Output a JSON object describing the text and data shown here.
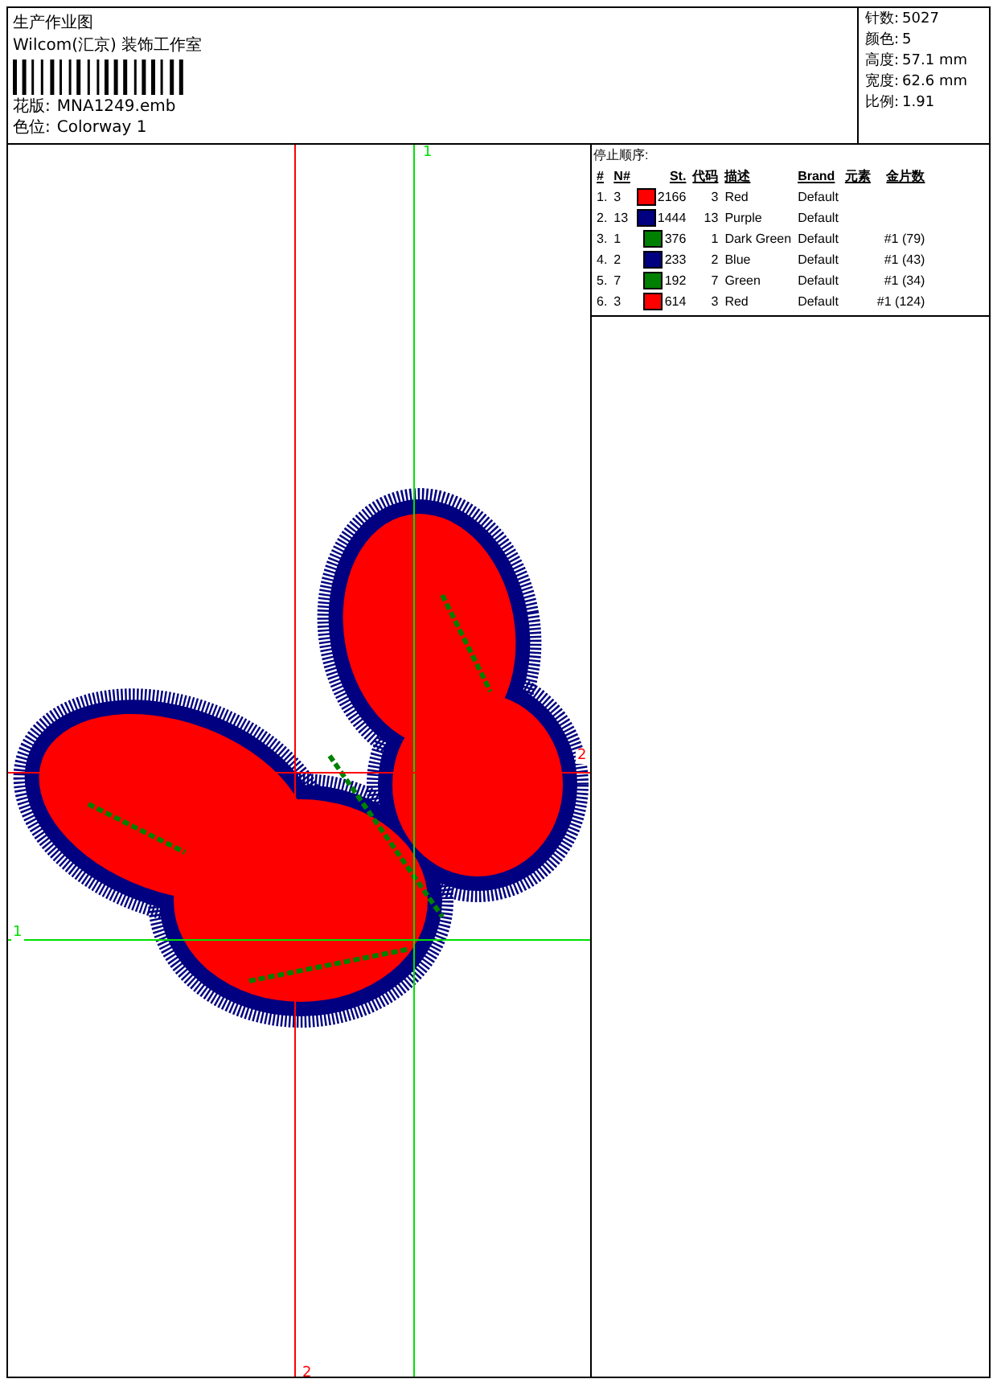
{
  "header": {
    "title": "生产作业图",
    "studio": "Wilcom(汇京) 装饰工作室",
    "fields": [
      {
        "label": "花版:",
        "value": "MNA1249.emb"
      },
      {
        "label": "色位:",
        "value": "Colorway 1"
      }
    ]
  },
  "stats": [
    {
      "label": "针数:",
      "value": "5027"
    },
    {
      "label": "颜色:",
      "value": "5"
    },
    {
      "label": "高度:",
      "value": "57.1 mm"
    },
    {
      "label": "宽度:",
      "value": "62.6 mm"
    },
    {
      "label": "比例:",
      "value": "1.91"
    }
  ],
  "canvas": {
    "guide_labels": [
      {
        "text": "1",
        "color": "#00e000"
      },
      {
        "text": "1",
        "color": "#00e000"
      },
      {
        "text": "2",
        "color": "#ff0000"
      },
      {
        "text": "2",
        "color": "#ff0000"
      }
    ]
  },
  "stop_sequence": {
    "title": "停止顺序:",
    "columns": [
      "#",
      "N#",
      "St.",
      "代码",
      "描述",
      "Brand",
      "元素",
      "金片数"
    ],
    "rows": [
      {
        "index": "1.",
        "n": "3",
        "color": "#ff0000",
        "stitches": "2166",
        "code": "3",
        "description": "Red",
        "brand": "Default"
      },
      {
        "index": "2.",
        "n": "13",
        "color": "#000080",
        "stitches": "1444",
        "code": "13",
        "description": "Purple",
        "brand": "Default"
      },
      {
        "index": "3.",
        "n": "1",
        "color": "#008000",
        "stitches": "376",
        "code": "1",
        "description": "Dark Green",
        "brand": "Default",
        "sequins": "#1 (79)"
      },
      {
        "index": "4.",
        "n": "2",
        "color": "#000080",
        "stitches": "233",
        "code": "2",
        "description": "Blue",
        "brand": "Default",
        "sequins": "#1 (43)"
      },
      {
        "index": "5.",
        "n": "7",
        "color": "#008000",
        "stitches": "192",
        "code": "7",
        "description": "Green",
        "brand": "Default",
        "sequins": "#1 (34)"
      },
      {
        "index": "6.",
        "n": "3",
        "color": "#ff0000",
        "stitches": "614",
        "code": "3",
        "description": "Red",
        "brand": "Default",
        "sequins": "#1 (124)"
      }
    ]
  }
}
